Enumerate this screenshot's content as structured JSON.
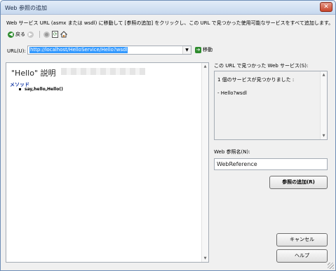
{
  "window": {
    "title": "Web 参照の追加",
    "close_glyph": "✕"
  },
  "instruction": "Web サービス URL (asmx または wsdl) に移動して [参照の追加] をクリックし、この URL で見つかった使用可能なサービスをすべて追加します。",
  "toolbar": {
    "back_label": "戻る",
    "back_glyph": "◀",
    "forward_glyph": "▶",
    "refresh_glyph": "⟳"
  },
  "url": {
    "label": "URL(U):",
    "value": "http://localhost/HelloService/Hello?wsdl",
    "dropdown_glyph": "▼",
    "go_label": "移動",
    "go_glyph": "➔"
  },
  "browser": {
    "title": "\"Hello\" 説明",
    "methods_heading": "メソッド",
    "methods": [
      "say,hello,Hello()"
    ]
  },
  "services": {
    "label": "この URL で見つかった Web サービス(S):",
    "result_line": "1 個のサービスが見つかりました :",
    "service_item": "- Hello?wsdl"
  },
  "reference": {
    "label": "Web 参照名(N):",
    "value": "WebReference"
  },
  "buttons": {
    "add": "参照の追加(R)",
    "cancel": "キャンセル",
    "help": "ヘルプ"
  },
  "scroll": {
    "up_glyph": "▲",
    "down_glyph": "▼"
  },
  "colors": {
    "selection": "#3399ff",
    "methods_heading": "#1a3ea8",
    "close_button": "#c8442a"
  }
}
